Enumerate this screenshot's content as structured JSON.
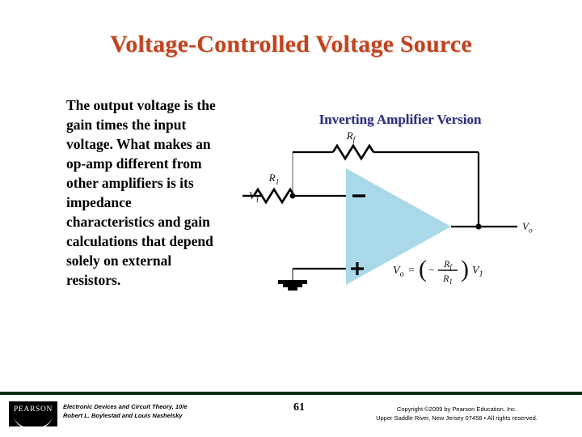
{
  "slide": {
    "title": "Voltage-Controlled Voltage Source",
    "title_color": "#c1431e",
    "background": "#ffffff"
  },
  "body": {
    "paragraph": "The output voltage is the gain times the input voltage. What makes an op-amp different from other amplifiers is its impedance characteristics and gain calculations that depend solely on external resistors."
  },
  "figure": {
    "heading": "Inverting Amplifier Version",
    "heading_color": "#2e2e7a",
    "opamp_fill_color": "#a9d9e8",
    "wire_color": "#000000",
    "labels": {
      "input_source": "V",
      "input_source_sub": "1",
      "input_resistor": "R",
      "input_resistor_sub": "1",
      "feedback_resistor": "R",
      "feedback_resistor_sub": "f",
      "output": "V",
      "output_sub": "o",
      "inverting_terminal": "−",
      "noninverting_terminal": "+",
      "ground": "ground-symbol"
    },
    "equation": {
      "lhs": "V",
      "lhs_sub": "o",
      "equals": "=",
      "open_paren": "(",
      "minus": "−",
      "numerator": "R",
      "numerator_sub": "f",
      "denominator": "R",
      "denominator_sub": "1",
      "close_paren": ")",
      "rhs": "V",
      "rhs_sub": "1",
      "plain": "Vo = ( − Rf / R1 ) V1"
    }
  },
  "footer": {
    "rule_color": "#0b2c10",
    "logo_text": "PEARSON",
    "book_title_line": "Electronic Devices and Circuit Theory, 10/e",
    "authors_line": "Robert L. Boylestad and Louis Nashelsky",
    "page_number": "61",
    "copyright_line1": "Copyright ©2009 by Pearson Education, Inc.",
    "copyright_line2": "Upper Saddle River, New Jersey 07458 • All rights reserved."
  }
}
